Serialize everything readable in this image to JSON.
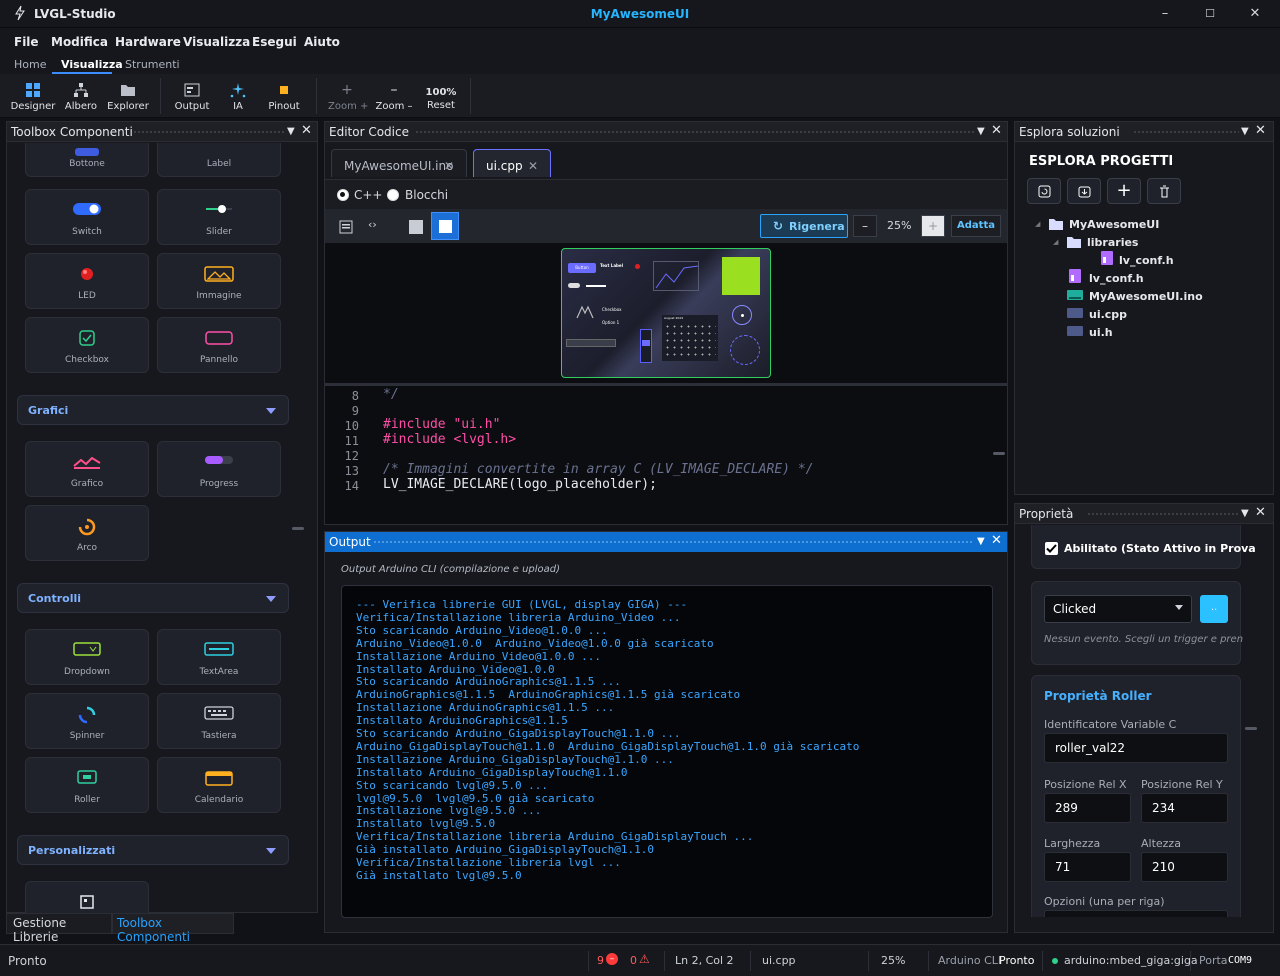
{
  "app": {
    "name": "LVGL-Studio",
    "window_title": "MyAwesomeUI",
    "minimize": "–",
    "maximize": "☐",
    "close": "✕"
  },
  "menu": [
    "File",
    "Modifica",
    "Hardware",
    "Visualizza",
    "Esegui",
    "Aiuto"
  ],
  "ribbon_tabs": [
    "Home",
    "Visualizza",
    "Strumenti"
  ],
  "toolbar": {
    "designer": "Designer",
    "albero": "Albero",
    "explorer": "Explorer",
    "output": "Output",
    "ia": "IA",
    "pinout": "Pinout",
    "zoom_in": "Zoom +",
    "zoom_out": "Zoom –",
    "zoom_pct": "100%",
    "reset": "Reset"
  },
  "toolbox": {
    "title": "Toolbox Componenti",
    "items_top": [
      "Bottone",
      "Label",
      "Switch",
      "Slider",
      "LED",
      "Immagine",
      "Checkbox",
      "Pannello"
    ],
    "cat_grafici": "Grafici",
    "items_grafici": [
      "Grafico",
      "Progress",
      "Arco"
    ],
    "cat_controlli": "Controlli",
    "items_controlli": [
      "Dropdown",
      "TextArea",
      "Spinner",
      "Tastiera",
      "Roller",
      "Calendario"
    ],
    "cat_personalizzati": "Personalizzati",
    "bottom_tabs": [
      "Gestione Librerie",
      "Toolbox Componenti"
    ]
  },
  "editor": {
    "title": "Editor Codice",
    "tabs": [
      "MyAwesomeUI.ino",
      "ui.cpp"
    ],
    "tab_close": "✕",
    "modes": [
      "C++",
      "Blocchi"
    ],
    "regen": "Rigenera",
    "zoom_minus": "–",
    "zoom": "25%",
    "zoom_plus": "+",
    "fit": "Adatta",
    "preview": {
      "button": "Button",
      "text_label": "Text Label",
      "checkbox": "Checkbox",
      "option": "Option 1",
      "calendar": "August 2024"
    },
    "line_numbers": [
      "8",
      "9",
      "10",
      "11",
      "12",
      "13",
      "14"
    ],
    "lines": [
      "*/",
      "",
      "#include \"ui.h\"",
      "#include <lvgl.h>",
      "",
      "/* Immagini convertite in array C (LV_IMAGE_DECLARE) */",
      "LV_IMAGE_DECLARE(logo_placeholder);"
    ]
  },
  "output": {
    "title": "Output",
    "subtitle": "Output Arduino CLI (compilazione e upload)",
    "lines": [
      "--- Verifica librerie GUI (LVGL, display GIGA) ---",
      "Verifica/Installazione libreria Arduino_Video ...",
      "Sto scaricando Arduino_Video@1.0.0 ...",
      "Arduino_Video@1.0.0  Arduino_Video@1.0.0 già scaricato",
      "Installazione Arduino_Video@1.0.0 ...",
      "Installato Arduino_Video@1.0.0",
      "Sto scaricando ArduinoGraphics@1.1.5 ...",
      "ArduinoGraphics@1.1.5  ArduinoGraphics@1.1.5 già scaricato",
      "Installazione ArduinoGraphics@1.1.5 ...",
      "Installato ArduinoGraphics@1.1.5",
      "Sto scaricando Arduino_GigaDisplayTouch@1.1.0 ...",
      "Arduino_GigaDisplayTouch@1.1.0  Arduino_GigaDisplayTouch@1.1.0 già scaricato",
      "Installazione Arduino_GigaDisplayTouch@1.1.0 ...",
      "Installato Arduino_GigaDisplayTouch@1.1.0",
      "Sto scaricando lvgl@9.5.0 ...",
      "lvgl@9.5.0  lvgl@9.5.0 già scaricato",
      "Installazione lvgl@9.5.0 ...",
      "Installato lvgl@9.5.0",
      "Verifica/Installazione libreria Arduino_GigaDisplayTouch ...",
      "Già installato Arduino_GigaDisplayTouch@1.1.0",
      "Verifica/Installazione libreria lvgl ...",
      "Già installato lvgl@9.5.0"
    ]
  },
  "explorer": {
    "title": "Esplora soluzioni",
    "heading": "ESPLORA PROGETTI",
    "tree": [
      "MyAwesomeUI",
      "libraries",
      "lv_conf.h",
      "lv_conf.h",
      "MyAwesomeUI.ino",
      "ui.cpp",
      "ui.h"
    ]
  },
  "properties": {
    "title": "Proprietà",
    "enabled": "Abilitato (Stato Attivo in Prova",
    "event": "Clicked",
    "event_btn": "..",
    "event_hint": "Nessun evento. Scegli un trigger e pren",
    "section": "Proprietà Roller",
    "var_label": "Identificatore Variable C",
    "var": "roller_val22",
    "posx_label": "Posizione Rel X",
    "posx": "289",
    "posy_label": "Posizione Rel Y",
    "posy": "234",
    "w_label": "Larghezza",
    "w": "71",
    "h_label": "Altezza",
    "h": "210",
    "opts_label": "Opzioni (una per riga)"
  },
  "status": {
    "ready": "Pronto",
    "errors": "9",
    "warnings": "0",
    "pos": "Ln 2, Col 2",
    "file": "ui.cpp",
    "zoom": "25%",
    "cli_label": "Arduino CLI",
    "cli_state": "Pronto",
    "board": "arduino:mbed_giga:giga",
    "port_label": "Porta",
    "port": "COM9"
  },
  "colors": {
    "accent": "#27b5ff",
    "output_text": "#3aa6ff",
    "output_header": "#0f6fd0",
    "category_text": "#7fb2ff"
  }
}
